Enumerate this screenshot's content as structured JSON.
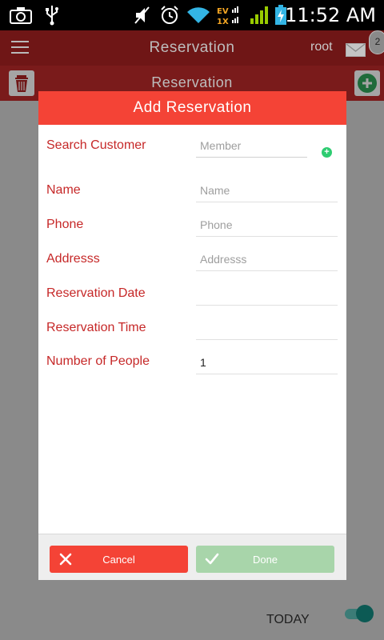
{
  "status_bar": {
    "time": "11:52 AM",
    "icons": [
      "camera-icon",
      "usb-icon",
      "mute-icon",
      "alarm-icon",
      "wifi-icon",
      "evdo-signal-icon",
      "signal-icon",
      "battery-charging-icon"
    ],
    "network_label": "EV\n1X"
  },
  "app_bar": {
    "title": "Reservation",
    "user": "root",
    "notification_count": "2"
  },
  "sub_bar": {
    "title": "Reservation"
  },
  "dialog": {
    "title": "Add Reservation",
    "fields": [
      {
        "label": "Search Customer",
        "placeholder": "Member",
        "value": ""
      },
      {
        "label": "Name",
        "placeholder": "Name",
        "value": ""
      },
      {
        "label": "Phone",
        "placeholder": "Phone",
        "value": ""
      },
      {
        "label": "Addresss",
        "placeholder": "Addresss",
        "value": ""
      },
      {
        "label": "Reservation Date",
        "placeholder": "",
        "value": ""
      },
      {
        "label": "Reservation Time",
        "placeholder": "",
        "value": ""
      },
      {
        "label": "Number of People",
        "placeholder": "",
        "value": "1"
      }
    ],
    "cancel_label": "Cancel",
    "done_label": "Done"
  },
  "bottom": {
    "today_label": "TODAY",
    "toggle_on": true
  },
  "colors": {
    "accent": "#f44336",
    "label": "#c62828",
    "done": "#a8d5aa",
    "add_green": "#2ecc71"
  }
}
